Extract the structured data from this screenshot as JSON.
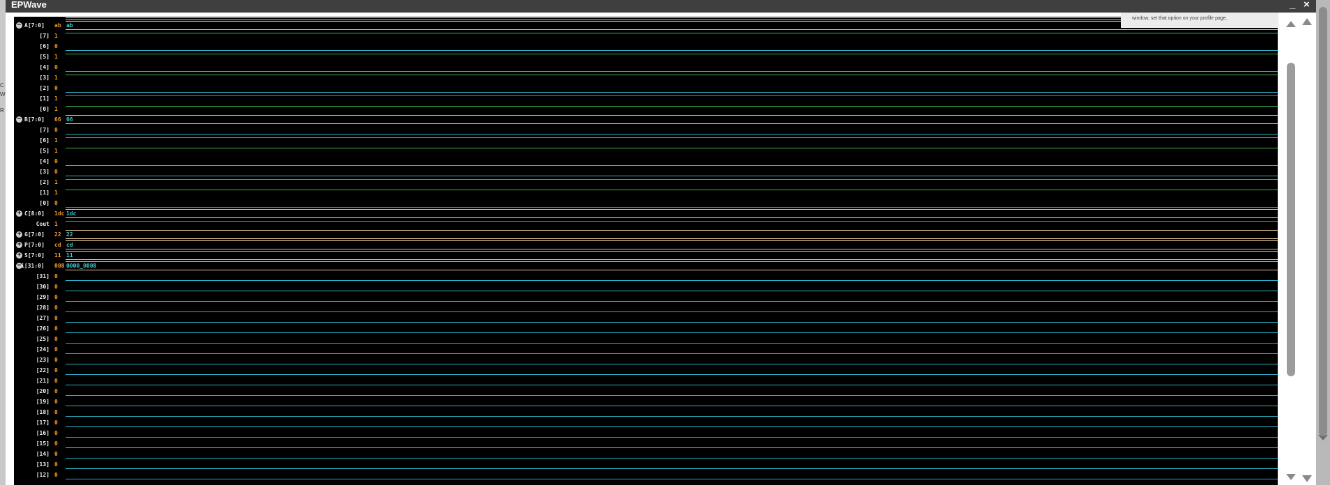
{
  "window": {
    "title": "EPWave",
    "minimize_label": "_",
    "close_label": "×"
  },
  "notice": {
    "text": "window, set that option on your profile page."
  },
  "background_page": {
    "left_fragments": [
      "C",
      "W",
      "R"
    ]
  },
  "colors": {
    "panel_bg": "#000000",
    "signal_name": "#f0f0f0",
    "cursor_value": "#ff9d2b",
    "bit_low": "#2ab4c8",
    "bit_high": "#3fb54c",
    "bus_edge": "#e8c89a",
    "bus_label": "#3fd0d8"
  },
  "signals": [
    {
      "name": "A[7:0]",
      "value": "ab",
      "kind": "bus",
      "expander": "−",
      "bus_value": "ab"
    },
    {
      "name": "[7]",
      "value": "1",
      "kind": "bit",
      "level": 1
    },
    {
      "name": "[6]",
      "value": "0",
      "kind": "bit",
      "level": 0
    },
    {
      "name": "[5]",
      "value": "1",
      "kind": "bit",
      "level": 1
    },
    {
      "name": "[4]",
      "value": "0",
      "kind": "bit",
      "level": 0
    },
    {
      "name": "[3]",
      "value": "1",
      "kind": "bit",
      "level": 1
    },
    {
      "name": "[2]",
      "value": "0",
      "kind": "bit",
      "level": 0
    },
    {
      "name": "[1]",
      "value": "1",
      "kind": "bit",
      "level": 1
    },
    {
      "name": "[0]",
      "value": "1",
      "kind": "bit",
      "level": 1
    },
    {
      "name": "B[7:0]",
      "value": "66",
      "kind": "bus",
      "expander": "−",
      "bus_value": "66"
    },
    {
      "name": "[7]",
      "value": "0",
      "kind": "bit",
      "level": 0
    },
    {
      "name": "[6]",
      "value": "1",
      "kind": "bit",
      "level": 1
    },
    {
      "name": "[5]",
      "value": "1",
      "kind": "bit",
      "level": 1
    },
    {
      "name": "[4]",
      "value": "0",
      "kind": "bit",
      "level": 0
    },
    {
      "name": "[3]",
      "value": "0",
      "kind": "bit",
      "level": 0
    },
    {
      "name": "[2]",
      "value": "1",
      "kind": "bit",
      "level": 1
    },
    {
      "name": "[1]",
      "value": "1",
      "kind": "bit",
      "level": 1
    },
    {
      "name": "[0]",
      "value": "0",
      "kind": "bit",
      "level": 0
    },
    {
      "name": "C[8:0]",
      "value": "1dc",
      "kind": "bus",
      "expander": "+",
      "bus_value": "1dc"
    },
    {
      "name": "Cout",
      "value": "1",
      "kind": "bit",
      "level": 1
    },
    {
      "name": "G[7:0]",
      "value": "22",
      "kind": "bus",
      "expander": "+",
      "bus_value": "22"
    },
    {
      "name": "P[7:0]",
      "value": "cd",
      "kind": "bus",
      "expander": "+",
      "bus_value": "cd"
    },
    {
      "name": "S[7:0]",
      "value": "11",
      "kind": "bus",
      "expander": "+",
      "bus_value": "11"
    },
    {
      "name": "i[31:0]",
      "value": "008",
      "kind": "bus",
      "expander": "−",
      "bus_value": "0000_0008"
    },
    {
      "name": "[31]",
      "value": "0",
      "kind": "bit",
      "level": 0
    },
    {
      "name": "[30]",
      "value": "0",
      "kind": "bit",
      "level": 0
    },
    {
      "name": "[29]",
      "value": "0",
      "kind": "bit",
      "level": 0
    },
    {
      "name": "[28]",
      "value": "0",
      "kind": "bit",
      "level": 0
    },
    {
      "name": "[27]",
      "value": "0",
      "kind": "bit",
      "level": 0
    },
    {
      "name": "[26]",
      "value": "0",
      "kind": "bit",
      "level": 0
    },
    {
      "name": "[25]",
      "value": "0",
      "kind": "bit",
      "level": 0
    },
    {
      "name": "[24]",
      "value": "0",
      "kind": "bit",
      "level": 0
    },
    {
      "name": "[23]",
      "value": "0",
      "kind": "bit",
      "level": 0
    },
    {
      "name": "[22]",
      "value": "0",
      "kind": "bit",
      "level": 0
    },
    {
      "name": "[21]",
      "value": "0",
      "kind": "bit",
      "level": 0
    },
    {
      "name": "[20]",
      "value": "0",
      "kind": "bit",
      "level": 0
    },
    {
      "name": "[19]",
      "value": "0",
      "kind": "bit",
      "level": 0
    },
    {
      "name": "[18]",
      "value": "0",
      "kind": "bit",
      "level": 0
    },
    {
      "name": "[17]",
      "value": "0",
      "kind": "bit",
      "level": 0
    },
    {
      "name": "[16]",
      "value": "0",
      "kind": "bit",
      "level": 0
    },
    {
      "name": "[15]",
      "value": "0",
      "kind": "bit",
      "level": 0
    },
    {
      "name": "[14]",
      "value": "0",
      "kind": "bit",
      "level": 0
    },
    {
      "name": "[13]",
      "value": "0",
      "kind": "bit",
      "level": 0
    },
    {
      "name": "[12]",
      "value": "0",
      "kind": "bit",
      "level": 0
    }
  ]
}
